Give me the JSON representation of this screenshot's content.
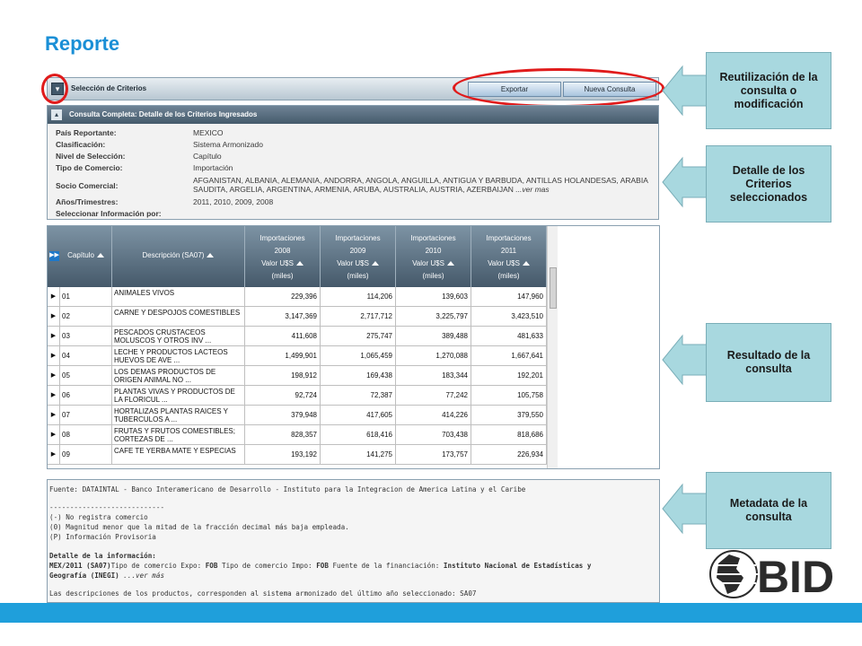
{
  "slide": {
    "title": "Reporte"
  },
  "criteria_bar": {
    "label": "Selección de Criterios",
    "toggle_glyph": "▾",
    "export_label": "Exportar",
    "new_query_label": "Nueva Consulta"
  },
  "details": {
    "header": "Consulta Completa:  Detalle de los Criterios Ingresados",
    "toggle_glyph": "▴",
    "fields": [
      {
        "label": "País Reportante:",
        "value": "MEXICO"
      },
      {
        "label": "Clasificación:",
        "value": "Sistema Armonizado"
      },
      {
        "label": "Nivel de Selección:",
        "value": "Capítulo"
      },
      {
        "label": "Tipo de Comercio:",
        "value": "Importación"
      },
      {
        "label": "Socio Comercial:",
        "value": "AFGANISTAN, ALBANIA, ALEMANIA, ANDORRA, ANGOLA, ANGUILLA, ANTIGUA Y BARBUDA, ANTILLAS HOLANDESAS, ARABIA SAUDITA, ARGELIA, ARGENTINA, ARMENIA, ARUBA, AUSTRALIA, AUSTRIA, AZERBAIJAN",
        "more": "...ver mas"
      },
      {
        "label": "Años/Trimestres:",
        "value": "2011, 2010, 2009, 2008"
      },
      {
        "label": "Seleccionar Información por:",
        "value": ""
      }
    ]
  },
  "table": {
    "columns": [
      {
        "lines": [
          "Capítulo"
        ]
      },
      {
        "lines": [
          "Descripción (SA07)"
        ]
      },
      {
        "lines": [
          "Importaciones",
          "2008",
          "Valor U$S",
          "(miles)"
        ]
      },
      {
        "lines": [
          "Importaciones",
          "2009",
          "Valor U$S",
          "(miles)"
        ]
      },
      {
        "lines": [
          "Importaciones",
          "2010",
          "Valor U$S",
          "(miles)"
        ]
      },
      {
        "lines": [
          "Importaciones",
          "2011",
          "Valor U$S",
          "(miles)"
        ]
      }
    ],
    "rows": [
      {
        "cap": "01",
        "desc": "ANIMALES VIVOS",
        "v": [
          "229,396",
          "114,206",
          "139,603",
          "147,960"
        ]
      },
      {
        "cap": "02",
        "desc": "CARNE Y DESPOJOS COMESTIBLES",
        "v": [
          "3,147,369",
          "2,717,712",
          "3,225,797",
          "3,423,510"
        ]
      },
      {
        "cap": "03",
        "desc": "PESCADOS CRUSTACEOS MOLUSCOS Y OTROS INV ...",
        "v": [
          "411,608",
          "275,747",
          "389,488",
          "481,633"
        ]
      },
      {
        "cap": "04",
        "desc": "LECHE Y PRODUCTOS LACTEOS HUEVOS DE AVE ...",
        "v": [
          "1,499,901",
          "1,065,459",
          "1,270,088",
          "1,667,641"
        ]
      },
      {
        "cap": "05",
        "desc": "LOS DEMAS PRODUCTOS DE ORIGEN ANIMAL NO ...",
        "v": [
          "198,912",
          "169,438",
          "183,344",
          "192,201"
        ]
      },
      {
        "cap": "06",
        "desc": "PLANTAS VIVAS Y PRODUCTOS DE LA FLORICUL ...",
        "v": [
          "92,724",
          "72,387",
          "77,242",
          "105,758"
        ]
      },
      {
        "cap": "07",
        "desc": "HORTALIZAS PLANTAS RAICES Y TUBERCULOS A ...",
        "v": [
          "379,948",
          "417,605",
          "414,226",
          "379,550"
        ]
      },
      {
        "cap": "08",
        "desc": "FRUTAS Y FRUTOS COMESTIBLES; CORTEZAS DE ...",
        "v": [
          "828,357",
          "618,416",
          "703,438",
          "818,686"
        ]
      },
      {
        "cap": "09",
        "desc": "CAFE TE YERBA MATE Y ESPECIAS",
        "v": [
          "193,192",
          "141,275",
          "173,757",
          "226,934"
        ]
      }
    ]
  },
  "metadata": {
    "source": "Fuente: DATAINTAL - Banco Interamericano de Desarrollo - Instituto para la Integracion de America Latina y el Caribe",
    "separator": "----------------------------",
    "legend": [
      "(-) No registra comercio",
      "(0) Magnitud menor que la mitad de la fracción decimal más baja empleada.",
      "(P) Información Provisoria"
    ],
    "detail_title": "Detalle de la información:",
    "detail_code": "MEX/2011 (SA07)",
    "expo_label": "Tipo de comercio Expo: ",
    "expo_value": "FOB",
    "impo_label": " Tipo de comercio Impo: ",
    "impo_value": "FOB",
    "fin_label": " Fuente de la financiación: ",
    "fin_value": "Instituto Nacional de Estadísticas y",
    "fin_value2": "Geografía (INEGI)",
    "more": " ...ver más",
    "note": "Las descripciones de los productos, corresponden al sistema armonizado del último año seleccionado: SA07"
  },
  "callouts": {
    "reuse": "Reutilización de la consulta o modificación",
    "detail": "Detalle de los Criterios seleccionados",
    "result": "Resultado de la consulta",
    "meta": "Metadata de la consulta"
  },
  "logo": {
    "text": "BID"
  },
  "colors": {
    "title": "#1a8fd6",
    "callout_bg": "#a8d8df",
    "highlight_red": "#e01b1b",
    "bottom_bar": "#1f9fdb",
    "header_dark": "#45596a"
  }
}
